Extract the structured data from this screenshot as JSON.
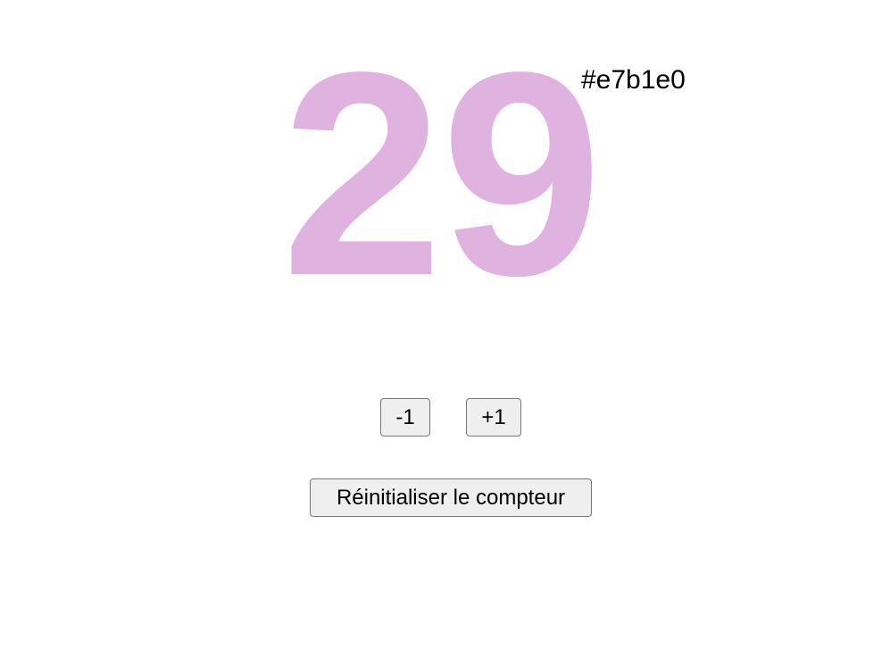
{
  "counter": {
    "value": "29",
    "color_label": "#e7b1e0",
    "display_color": "#e0b2e0"
  },
  "controls": {
    "decrement_label": "-1",
    "increment_label": "+1",
    "reset_label": "Réinitialiser le compteur"
  }
}
